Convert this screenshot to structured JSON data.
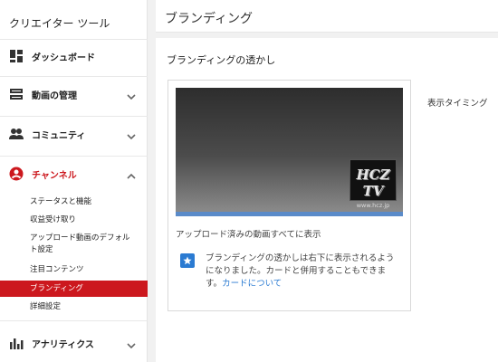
{
  "sidebar": {
    "title": "クリエイター ツール",
    "items": [
      {
        "label": "ダッシュボード",
        "icon": "dashboard-icon",
        "has_chevron": false
      },
      {
        "label": "動画の管理",
        "icon": "video-manager-icon",
        "has_chevron": true
      },
      {
        "label": "コミュニティ",
        "icon": "community-icon",
        "has_chevron": true
      },
      {
        "label": "チャンネル",
        "icon": "channel-icon",
        "has_chevron": true,
        "active": true
      },
      {
        "label": "アナリティクス",
        "icon": "analytics-icon",
        "has_chevron": true
      }
    ],
    "channel_subitems": [
      {
        "label": "ステータスと機能"
      },
      {
        "label": "収益受け取り"
      },
      {
        "label": "アップロード動画のデフォルト設定"
      },
      {
        "label": "注目コンテンツ"
      },
      {
        "label": "ブランディング",
        "active": true
      },
      {
        "label": "詳細設定"
      }
    ]
  },
  "page": {
    "title": "ブランディング"
  },
  "watermark_section": {
    "title": "ブランディングの透かし",
    "watermark_line1": "HCZ TV",
    "watermark_line2": "www.hcz.jp",
    "caption": "アップロード済みの動画すべてに表示",
    "info_text": "ブランディングの透かしは右下に表示されるようになりました。カードと併用することもできます。",
    "info_link": "カードについて",
    "timing_label": "表示タイミング"
  },
  "colors": {
    "accent_red": "#cc181e",
    "link_blue": "#2b7bd2",
    "progress_blue": "#5a8bc9"
  }
}
